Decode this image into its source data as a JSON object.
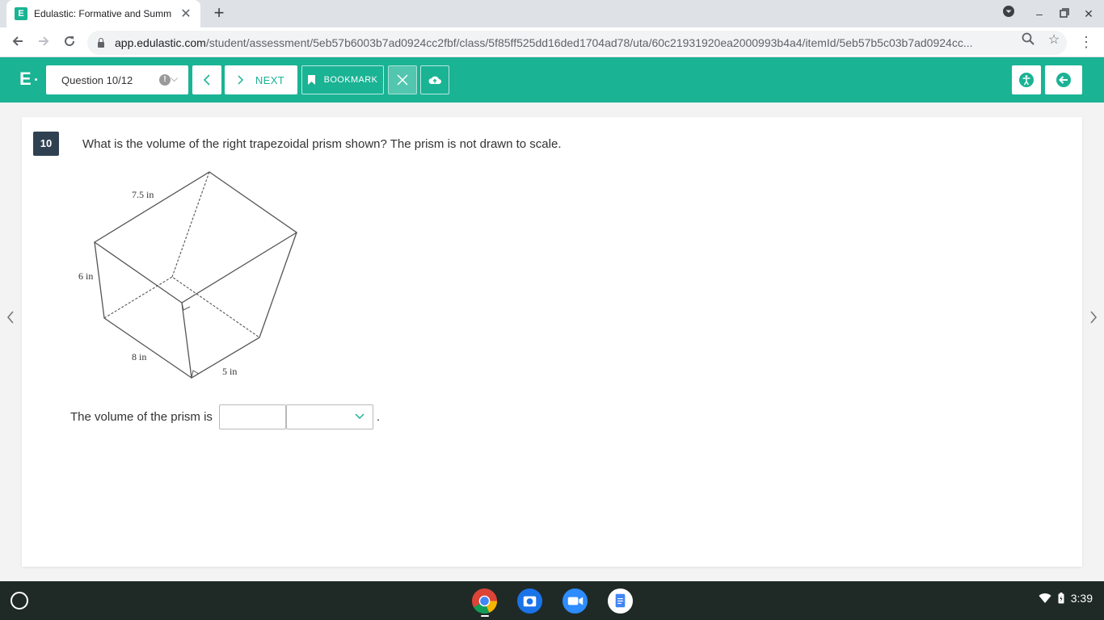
{
  "browser": {
    "tab_title": "Edulastic: Formative and Summ",
    "tab_favicon_letter": "E",
    "url_host": "app.edulastic.com",
    "url_path": "/student/assessment/5eb57b6003b7ad0924cc2fbf/class/5f85ff525dd16ded1704ad78/uta/60c21931920ea2000993b4a4/itemId/5eb57b5c03b7ad0924cc..."
  },
  "toolbar": {
    "logo": "E",
    "question_selector": "Question 10/12",
    "prev_label": "<",
    "next_label": "NEXT",
    "bookmark_label": "BOOKMARK"
  },
  "question": {
    "number": "10",
    "text": "What is the volume of the right trapezoidal prism shown?  The prism is not drawn to scale.",
    "figure_labels": {
      "top_edge": "7.5 in",
      "left_edge": "6 in",
      "bottom_left": "8 in",
      "bottom_right": "5 in"
    },
    "answer_prefix": "The volume of the prism is",
    "answer_value": "",
    "unit_selected": "",
    "answer_suffix": "."
  },
  "shelf": {
    "time": "3:39"
  },
  "colors": {
    "accent": "#1ab394",
    "question_badge": "#2f4151",
    "shelf": "#1f2a26"
  }
}
